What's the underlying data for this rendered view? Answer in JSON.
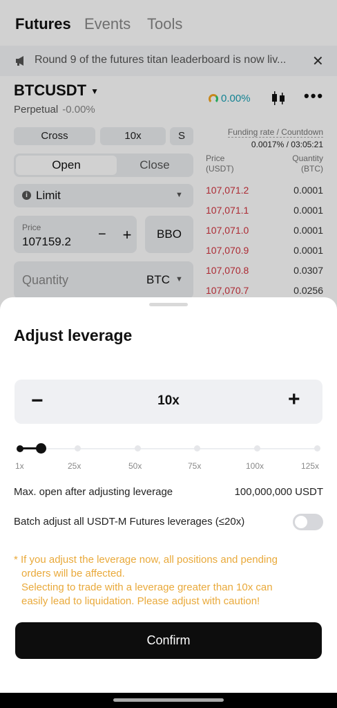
{
  "nav": {
    "tabs": [
      "Futures",
      "Events",
      "Tools"
    ]
  },
  "banner": {
    "text": "Round 9 of the futures titan leaderboard is now liv...",
    "close": "✕"
  },
  "ticker": {
    "pair": "BTCUSDT",
    "type": "Perpetual",
    "change": "-0.00%",
    "rate_display": "0.00%"
  },
  "order_form": {
    "margin_mode": "Cross",
    "leverage": "10x",
    "mode_s": "S",
    "side_open": "Open",
    "side_close": "Close",
    "order_type": "Limit",
    "price_label": "Price",
    "price_value": "107159.2",
    "bbo": "BBO",
    "quantity_label": "Quantity",
    "quantity_unit": "BTC"
  },
  "funding": {
    "label": "Funding rate / Countdown",
    "value": "0.0017% / 03:05:21"
  },
  "orderbook": {
    "price_header": [
      "Price",
      "(USDT)"
    ],
    "qty_header": [
      "Quantity",
      "(BTC)"
    ],
    "rows": [
      {
        "price": "107,071.2",
        "qty": "0.0001"
      },
      {
        "price": "107,071.1",
        "qty": "0.0001"
      },
      {
        "price": "107,071.0",
        "qty": "0.0001"
      },
      {
        "price": "107,070.9",
        "qty": "0.0001"
      },
      {
        "price": "107,070.8",
        "qty": "0.0307"
      },
      {
        "price": "107,070.7",
        "qty": "0.0256"
      }
    ]
  },
  "sheet": {
    "title": "Adjust leverage",
    "leverage_value": "10x",
    "slider_ticks": [
      "1x",
      "25x",
      "50x",
      "75x",
      "100x",
      "125x"
    ],
    "slider_level": 10,
    "max_open_label": "Max. open after adjusting leverage",
    "max_open_value": "100,000,000 USDT",
    "batch_label": "Batch adjust all USDT-M Futures leverages (≤20x)",
    "batch_enabled": false,
    "warning_lines": [
      "* If you adjust the leverage now, all positions and pending",
      "orders will be affected.",
      "Selecting to trade with a leverage greater than 10x can",
      "easily lead to liquidation. Please adjust with caution!"
    ],
    "confirm": "Confirm"
  }
}
